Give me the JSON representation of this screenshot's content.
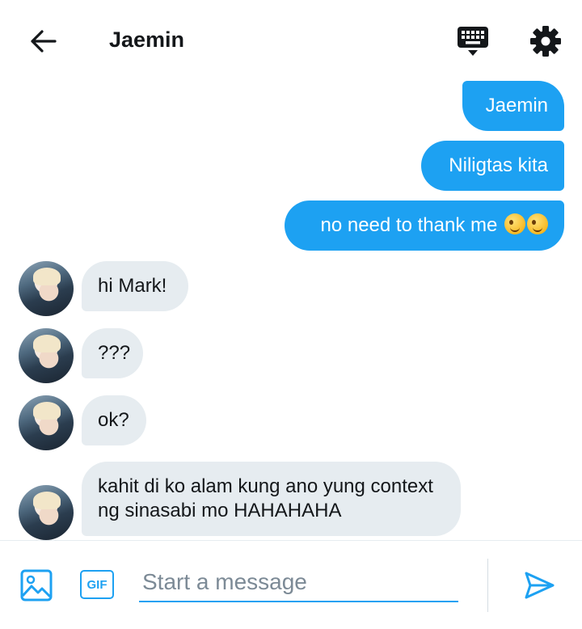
{
  "header": {
    "title": "Jaemin"
  },
  "messages": [
    {
      "direction": "outgoing",
      "text": "Jaemin"
    },
    {
      "direction": "outgoing",
      "text": "Niligtas kita"
    },
    {
      "direction": "outgoing",
      "text": "no need to thank me",
      "emoji": "winking-face x2"
    },
    {
      "direction": "incoming",
      "text": "hi Mark!"
    },
    {
      "direction": "incoming",
      "text": "???"
    },
    {
      "direction": "incoming",
      "text": "ok?"
    },
    {
      "direction": "incoming",
      "text": "kahit di ko alam kung ano yung context ng sinasabi mo HAHAHAHA"
    }
  ],
  "composer": {
    "placeholder": "Start a message",
    "value": "",
    "gif_label": "GIF"
  },
  "colors": {
    "accent": "#1da1f2",
    "incoming_bubble": "#e6ecf0",
    "text": "#14171a"
  },
  "icons": {
    "back": "arrow-left-icon",
    "keyboard": "keyboard-icon",
    "settings": "gear-icon",
    "image": "image-icon",
    "send": "send-icon"
  }
}
